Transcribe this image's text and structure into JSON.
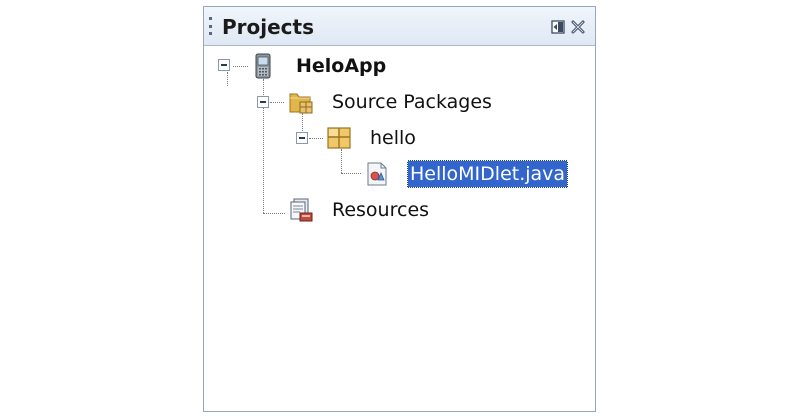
{
  "panel": {
    "title": "Projects",
    "minimize_icon": "minimize-window-icon",
    "close_icon": "close-icon"
  },
  "tree": {
    "project": {
      "label": "HeloApp",
      "icon": "mobile-phone-project-icon",
      "expanded": true,
      "children": {
        "source_packages": {
          "label": "Source Packages",
          "icon": "source-packages-folder-icon",
          "expanded": true,
          "package": {
            "label": "hello",
            "icon": "package-icon",
            "expanded": true,
            "file": {
              "label": "HelloMIDlet.java",
              "icon": "midlet-file-icon",
              "selected": true
            }
          }
        },
        "resources": {
          "label": "Resources",
          "icon": "resources-icon"
        }
      }
    }
  },
  "colors": {
    "selection": "#3366cc",
    "title_bar": "#dfe8f4",
    "border": "#9aa7b8"
  }
}
